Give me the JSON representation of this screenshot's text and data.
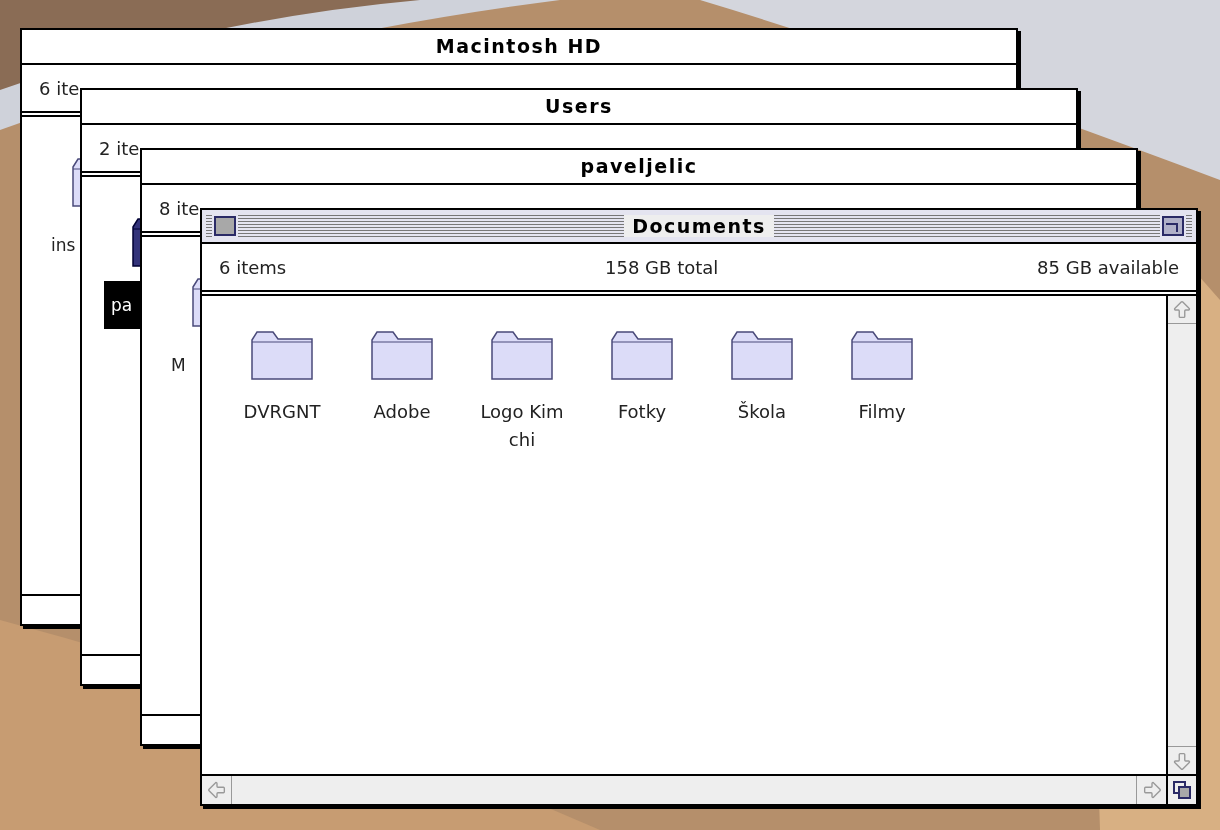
{
  "windows": [
    {
      "title": "Macintosh HD",
      "active": false,
      "info": [
        "6 ite"
      ],
      "items": [
        {
          "label": "ins",
          "selected": false
        }
      ]
    },
    {
      "title": "Users",
      "active": false,
      "info": [
        "2 ite"
      ],
      "items": [
        {
          "label": "pa",
          "selected": true
        }
      ]
    },
    {
      "title": "paveljelic",
      "active": false,
      "info": [
        "8 ite"
      ],
      "items": [
        {
          "label": "M",
          "selected": false
        }
      ]
    },
    {
      "title": "Documents",
      "active": true,
      "info": [
        "6 items",
        "158 GB total",
        "85 GB available"
      ],
      "items": [
        {
          "label": "DVRGNT",
          "selected": false
        },
        {
          "label": "Adobe",
          "selected": false
        },
        {
          "label": "Logo Kim chi",
          "selected": false
        },
        {
          "label": "Fotky",
          "selected": false
        },
        {
          "label": "Škola",
          "selected": false
        },
        {
          "label": "Filmy",
          "selected": false
        }
      ]
    }
  ]
}
